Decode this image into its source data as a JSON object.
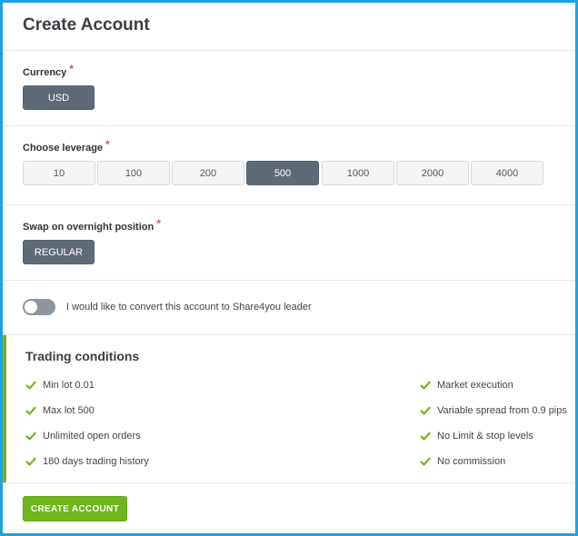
{
  "page": {
    "title": "Create Account"
  },
  "currency": {
    "label": "Currency",
    "required": "*",
    "selected": "USD"
  },
  "leverage": {
    "label": "Choose leverage",
    "required": "*",
    "options": [
      "10",
      "100",
      "200",
      "500",
      "1000",
      "2000",
      "4000"
    ],
    "selected": "500"
  },
  "swap": {
    "label": "Swap on overnight position",
    "required": "*",
    "selected": "REGULAR"
  },
  "share4you": {
    "label": "I would like to convert this account to Share4you leader",
    "enabled": false
  },
  "conditions": {
    "title": "Trading conditions",
    "left": [
      "Min lot 0.01",
      "Max lot 500",
      "Unlimited open orders",
      "180 days trading history"
    ],
    "right": [
      "Market execution",
      "Variable spread from 0.9 pips",
      "No Limit & stop levels",
      "No commission"
    ]
  },
  "actions": {
    "create_label": "CREATE ACCOUNT"
  },
  "colors": {
    "accent_green": "#6fb51c",
    "frame_blue": "#1fa2e1",
    "button_dark": "#5f6a77",
    "required_red": "#d9534f"
  },
  "icons": {
    "condition_icon": "checkmark-icon"
  }
}
